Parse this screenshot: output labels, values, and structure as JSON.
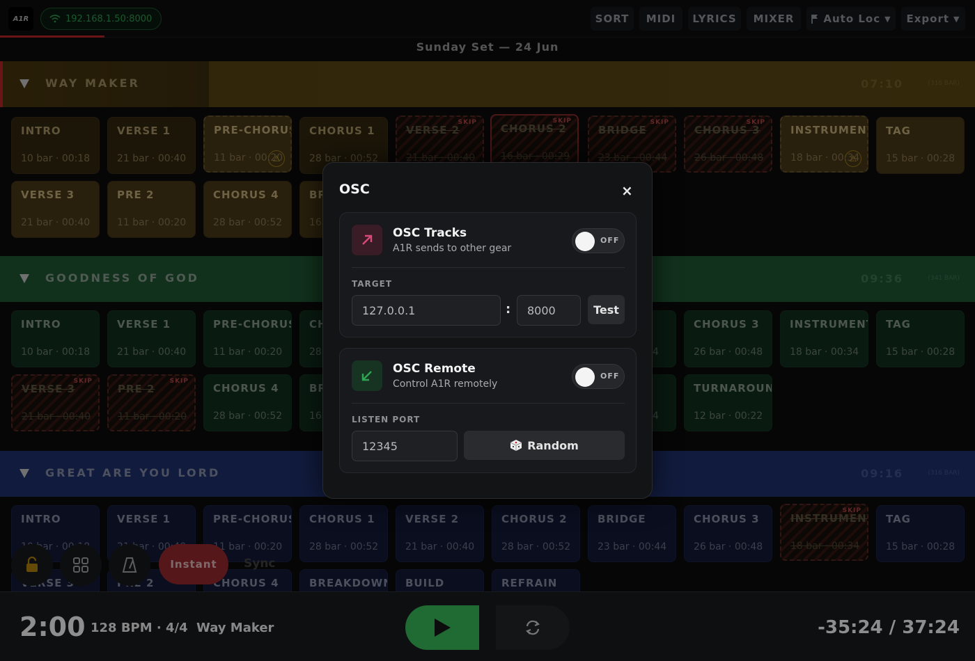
{
  "header": {
    "logo_text": "A1R",
    "ip_address": "192.168.1.50:8000",
    "nav": [
      "SORT",
      "MIDI",
      "LYRICS",
      "MIXER"
    ],
    "autoloc_label": "Auto Loc",
    "export_label": "Export",
    "set_title": "Sunday Set — 24 Jun"
  },
  "songs": [
    {
      "name": "WAY MAKER",
      "time": "07:10",
      "bars": "(316 BAR)",
      "sections": [
        {
          "name": "INTRO",
          "meta": "10 bar · 00:18"
        },
        {
          "name": "VERSE 1",
          "meta": "21 bar · 00:40"
        },
        {
          "name": "PRE-CHORUS",
          "meta": "11 bar · 00:20",
          "warning": true
        },
        {
          "name": "CHORUS 1",
          "meta": "28 bar · 00:52"
        },
        {
          "name": "VERSE 2",
          "meta": "21 bar · 00:40",
          "skip": true
        },
        {
          "name": "CHORUS 2",
          "meta": "16 bar · 00:29",
          "skip": true
        },
        {
          "name": "BRIDGE",
          "meta": "23 bar · 00:44",
          "skip": true
        },
        {
          "name": "CHORUS 3",
          "meta": "26 bar · 00:48",
          "skip": true
        },
        {
          "name": "INSTRUMENTAL",
          "meta": "18 bar · 00:34",
          "warning": true
        },
        {
          "name": "TAG",
          "meta": "15 bar · 00:28"
        },
        {
          "name": "VERSE 3",
          "meta": "21 bar · 00:40"
        },
        {
          "name": "PRE 2",
          "meta": "11 bar · 00:20"
        },
        {
          "name": "CHORUS 4",
          "meta": "28 bar · 00:52"
        },
        {
          "name": "BR",
          "meta": "16"
        }
      ]
    },
    {
      "name": "GOODNESS OF GOD",
      "time": "09:36",
      "bars": "(341 BAR)",
      "sections": [
        {
          "name": "INTRO",
          "meta": "10 bar · 00:18"
        },
        {
          "name": "VERSE 1",
          "meta": "21 bar · 00:40"
        },
        {
          "name": "PRE-CHORUS",
          "meta": "11 bar · 00:20"
        },
        {
          "name": "CH",
          "meta": "28"
        },
        {
          "name": "",
          "meta": "4"
        },
        {
          "name": "CHORUS 3",
          "meta": "26 bar · 00:48"
        },
        {
          "name": "INSTRUMENTAL",
          "meta": "18 bar · 00:34"
        },
        {
          "name": "TAG",
          "meta": "15 bar · 00:28"
        },
        {
          "name": "VERSE 3",
          "meta": "21 bar · 00:40",
          "skip": true
        },
        {
          "name": "PRE 2",
          "meta": "11 bar · 00:20",
          "skip": true
        },
        {
          "name": "CHORUS 4",
          "meta": "28 bar · 00:52"
        },
        {
          "name": "BR",
          "meta": "16"
        },
        {
          "name": "",
          "meta": "4"
        },
        {
          "name": "TURNAROUND",
          "meta": "12 bar · 00:22"
        }
      ]
    },
    {
      "name": "GREAT ARE YOU LORD",
      "time": "09:16",
      "bars": "(316 BAR)",
      "sections": [
        {
          "name": "INTRO",
          "meta": "10 bar · 00:18"
        },
        {
          "name": "VERSE 1",
          "meta": "21 bar · 00:40"
        },
        {
          "name": "PRE-CHORUS",
          "meta": "11 bar · 00:20"
        },
        {
          "name": "CHORUS 1",
          "meta": "28 bar · 00:52"
        },
        {
          "name": "VERSE 2",
          "meta": "21 bar · 00:40"
        },
        {
          "name": "CHORUS 2",
          "meta": "28 bar · 00:52"
        },
        {
          "name": "BRIDGE",
          "meta": "23 bar · 00:44"
        },
        {
          "name": "CHORUS 3",
          "meta": "26 bar · 00:48"
        },
        {
          "name": "INSTRUMENTAL",
          "meta": "18 bar · 00:34",
          "skip": true
        },
        {
          "name": "TAG",
          "meta": "15 bar · 00:28"
        },
        {
          "name": "VERSE 3",
          "meta": ""
        },
        {
          "name": "PRE 2",
          "meta": ""
        },
        {
          "name": "CHORUS 4",
          "meta": ""
        },
        {
          "name": "BREAKDOWN",
          "meta": ""
        },
        {
          "name": "BUILD",
          "meta": ""
        },
        {
          "name": "REFRAIN",
          "meta": ""
        }
      ]
    }
  ],
  "skip_label": "SKIP",
  "floating": {
    "instant_label": "Instant",
    "sync_label": "Sync"
  },
  "transport": {
    "clock": "2:00",
    "bpm_sig": "128 BPM · 4/4",
    "current_song": "Way Maker",
    "remaining": "-35:24 / 37:24"
  },
  "modal": {
    "title": "OSC",
    "close_icon": "×",
    "tracks": {
      "title": "OSC Tracks",
      "subtitle": "A1R sends to other gear",
      "toggle": "OFF",
      "target_label": "TARGET",
      "ip_value": "127.0.0.1",
      "separator": ":",
      "port_value": "8000",
      "test_label": "Test"
    },
    "remote": {
      "title": "OSC Remote",
      "subtitle": "Control A1R remotely",
      "toggle": "OFF",
      "listen_label": "LISTEN PORT",
      "port_value": "12345",
      "random_label": "Random"
    }
  },
  "colors": {
    "song1": "#6b5316",
    "song2": "#1c5a36",
    "song3": "#1f3270",
    "accent_red": "#c0272d",
    "play_green": "#1f6b33",
    "osc_tracks_icon": "#d84a77",
    "osc_remote_icon": "#2ea552"
  }
}
